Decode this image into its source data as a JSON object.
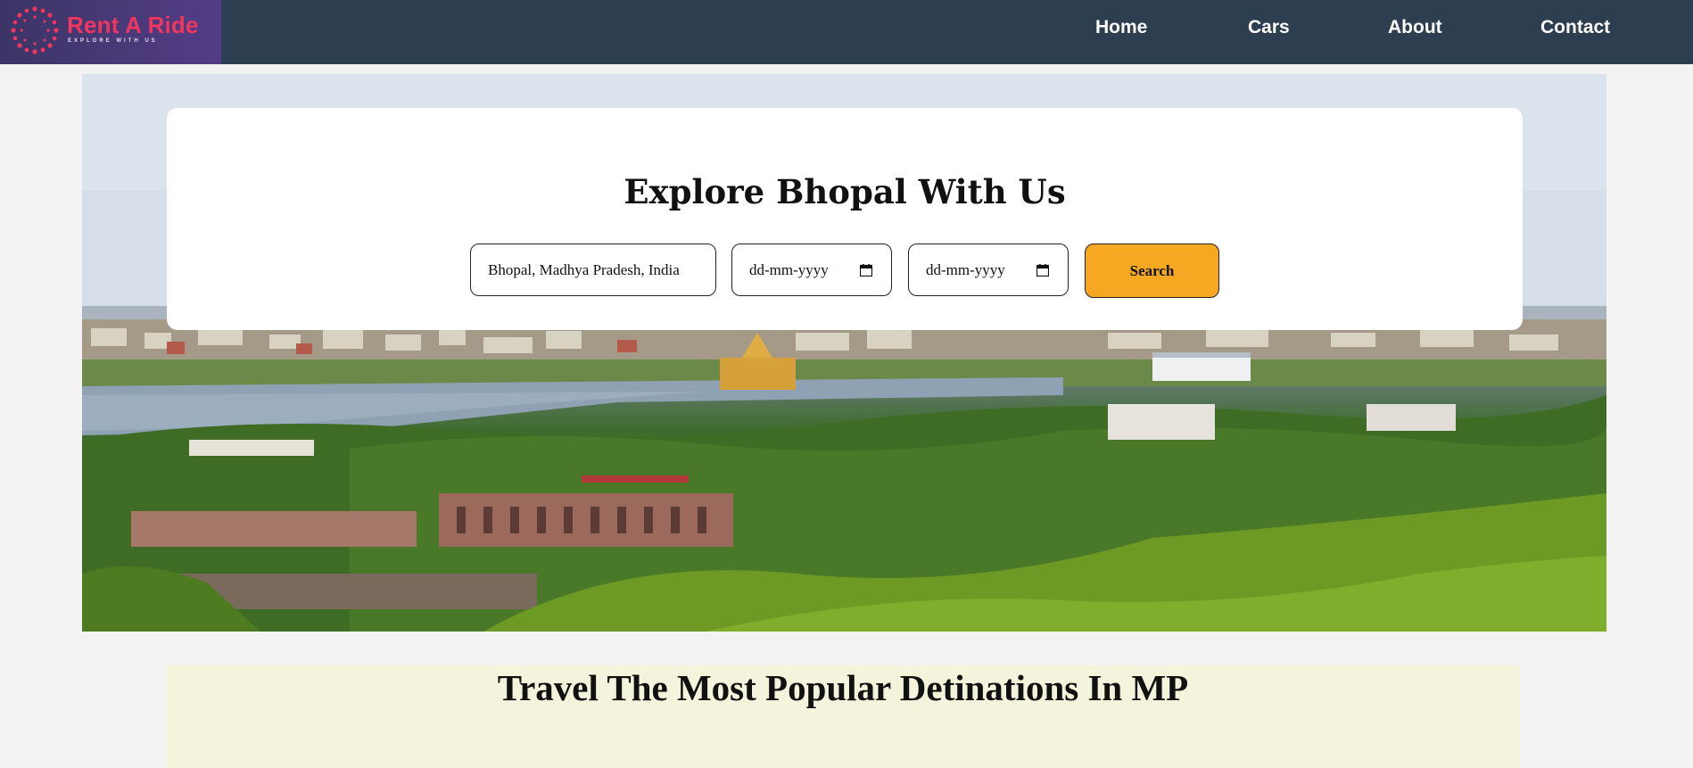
{
  "brand": {
    "name": "Rent A Ride",
    "tagline": "EXPLORE WITH US",
    "color": "#f0355f"
  },
  "nav": {
    "items": [
      {
        "label": "Home"
      },
      {
        "label": "Cars"
      },
      {
        "label": "About"
      },
      {
        "label": "Contact"
      }
    ]
  },
  "hero": {
    "image": "bhopal-lake-city-view",
    "search_card": {
      "title": "Explore Bhopal With Us",
      "location_value": "Bhopal, Madhya Pradesh, India",
      "pickup_date_placeholder": "dd-mm-yyyy",
      "return_date_placeholder": "dd-mm-yyyy",
      "calendar_icon": "calendar-icon",
      "search_label": "Search",
      "search_color": "#f7a823"
    }
  },
  "popular": {
    "title": "Travel The Most Popular Detinations In MP"
  },
  "colors": {
    "navbar": "#2d3e50",
    "page_bg": "#f3f3f3",
    "section_bg": "#f4f4dc"
  }
}
